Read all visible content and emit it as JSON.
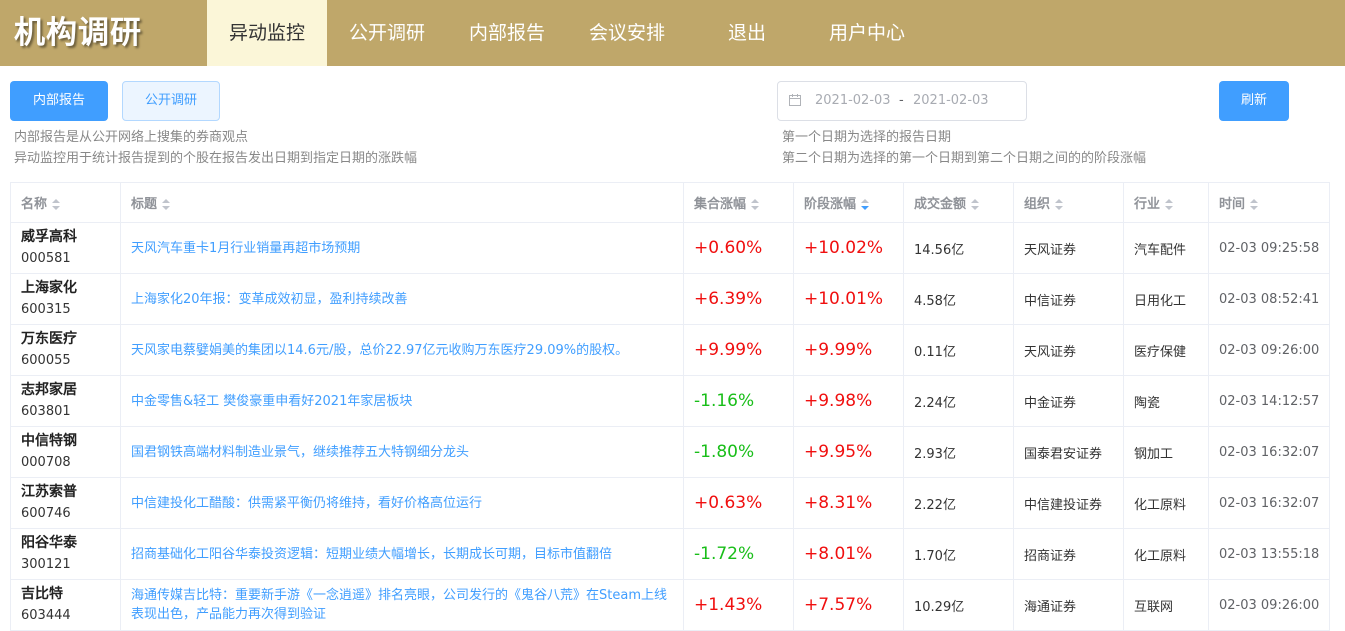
{
  "app": {
    "logo": "机构调研"
  },
  "nav": [
    {
      "label": "异动监控",
      "active": true
    },
    {
      "label": "公开调研",
      "active": false
    },
    {
      "label": "内部报告",
      "active": false
    },
    {
      "label": "会议安排",
      "active": false
    },
    {
      "label": "退出",
      "active": false
    },
    {
      "label": "用户中心",
      "active": false
    }
  ],
  "toolbar": {
    "internal_report_label": "内部报告",
    "public_research_label": "公开调研",
    "refresh_label": "刷新",
    "date_start": "2021-02-03",
    "date_sep": "-",
    "date_end": "2021-02-03"
  },
  "hints": {
    "left_1": "内部报告是从公开网络上搜集的券商观点",
    "left_2": "异动监控用于统计报告提到的个股在报告发出日期到指定日期的涨跌幅",
    "right_1": "第一个日期为选择的报告日期",
    "right_2": "第二个日期为选择的第一个日期到第二个日期之间的的阶段涨幅"
  },
  "table": {
    "columns": [
      "名称",
      "标题",
      "集合涨幅",
      "阶段涨幅",
      "成交金额",
      "组织",
      "行业",
      "时间"
    ],
    "sorted_column": "阶段涨幅",
    "rows": [
      {
        "name": "威孚高科",
        "code": "000581",
        "title": "天风汽车重卡1月行业销量再超市场预期",
        "auction_change": "+0.60%",
        "period_change": "+10.02%",
        "amount": "14.56亿",
        "org": "天风证券",
        "industry": "汽车配件",
        "time": "02-03 09:25:58"
      },
      {
        "name": "上海家化",
        "code": "600315",
        "title": "上海家化20年报：变革成效初显，盈利持续改善",
        "auction_change": "+6.39%",
        "period_change": "+10.01%",
        "amount": "4.58亿",
        "org": "中信证券",
        "industry": "日用化工",
        "time": "02-03 08:52:41"
      },
      {
        "name": "万东医疗",
        "code": "600055",
        "title": "天风家电蔡嬖娟美的集团以14.6元/股，总价22.97亿元收购万东医疗29.09%的股权。",
        "auction_change": "+9.99%",
        "period_change": "+9.99%",
        "amount": "0.11亿",
        "org": "天风证券",
        "industry": "医疗保健",
        "time": "02-03 09:26:00"
      },
      {
        "name": "志邦家居",
        "code": "603801",
        "title": "中金零售&轻工 樊俊豪重申看好2021年家居板块",
        "auction_change": "-1.16%",
        "period_change": "+9.98%",
        "amount": "2.24亿",
        "org": "中金证券",
        "industry": "陶瓷",
        "time": "02-03 14:12:57"
      },
      {
        "name": "中信特钢",
        "code": "000708",
        "title": "国君钢铁高端材料制造业景气，继续推荐五大特钢细分龙头",
        "auction_change": "-1.80%",
        "period_change": "+9.95%",
        "amount": "2.93亿",
        "org": "国泰君安证券",
        "industry": "钢加工",
        "time": "02-03 16:32:07"
      },
      {
        "name": "江苏索普",
        "code": "600746",
        "title": "中信建投化工醋酸：供需紧平衡仍将维持，看好价格高位运行",
        "auction_change": "+0.63%",
        "period_change": "+8.31%",
        "amount": "2.22亿",
        "org": "中信建投证券",
        "industry": "化工原料",
        "time": "02-03 16:32:07"
      },
      {
        "name": "阳谷华泰",
        "code": "300121",
        "title": "招商基础化工阳谷华泰投资逻辑：短期业绩大幅增长，长期成长可期，目标市值翻倍",
        "auction_change": "-1.72%",
        "period_change": "+8.01%",
        "amount": "1.70亿",
        "org": "招商证券",
        "industry": "化工原料",
        "time": "02-03 13:55:18"
      },
      {
        "name": "吉比特",
        "code": "603444",
        "title": "海通传媒吉比特：重要新手游《一念逍遥》排名亮眼，公司发行的《鬼谷八荒》在Steam上线表现出色，产品能力再次得到验证",
        "auction_change": "+1.43%",
        "period_change": "+7.57%",
        "amount": "10.29亿",
        "org": "海通证券",
        "industry": "互联网",
        "time": "02-03 09:26:00"
      }
    ]
  },
  "colors": {
    "header_bg": "#bfa76a",
    "active_tab_bg": "#fbf6d8",
    "primary": "#409eff",
    "rise": "#f00f0f",
    "fall": "#19be19"
  }
}
